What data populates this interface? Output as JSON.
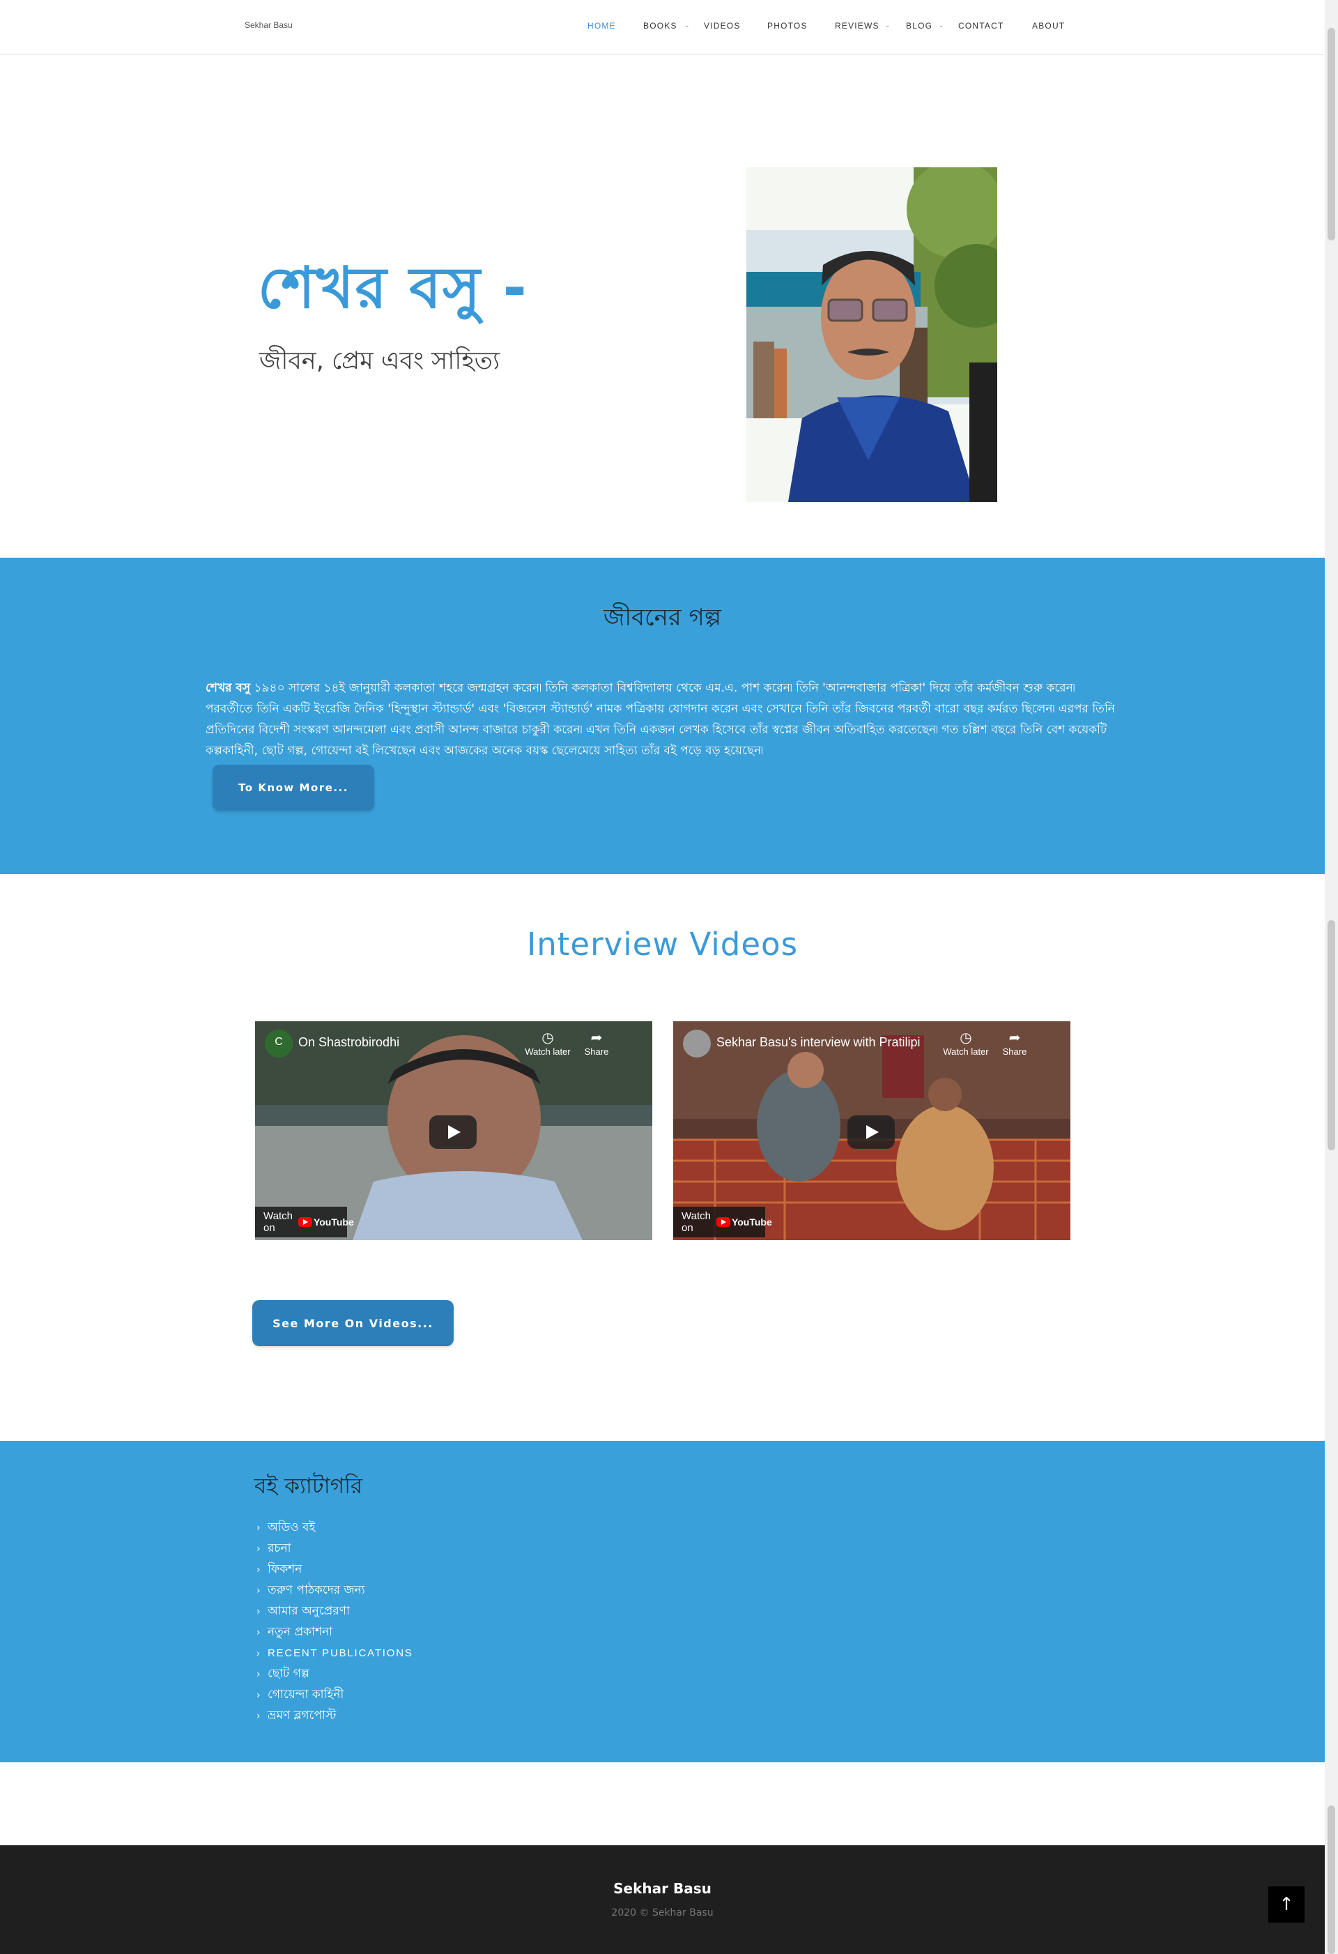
{
  "header": {
    "site_name": "Sekhar Basu",
    "nav": [
      {
        "label": "HOME",
        "active": true
      },
      {
        "label": "BOOKS",
        "has_dropdown": true
      },
      {
        "label": "VIDEOS"
      },
      {
        "label": "PHOTOS"
      },
      {
        "label": "REVIEWS",
        "has_dropdown": true
      },
      {
        "label": "BLOG",
        "has_dropdown": true
      },
      {
        "label": "CONTACT"
      },
      {
        "label": "ABOUT"
      }
    ]
  },
  "hero": {
    "title": "শেখর বসু -",
    "subtitle": "জীবন, প্রেম এবং সাহিত্য",
    "portrait_icon": "portrait-photo"
  },
  "about": {
    "heading": "জীবনের গল্প",
    "name_bold": "শেখর বসু",
    "text": " ১৯৪০ সালের ১৪ই জানুয়ারী কলকাতা শহরে জন্মগ্রহন করেন৷ তিনি কলকাতা বিশ্ববিদ্যালয় থেকে এম.এ. পাশ করেন৷ তিনি 'আনন্দবাজার পত্রিকা' দিয়ে তাঁর কর্মজীবন শুরু করেন৷ পরবর্তীতে তিনি একটি ইংরেজি দৈনিক 'হিন্দুস্থান স্ট্যান্ডার্ড' এবং 'বিজনেস স্ট্যান্ডার্ড' নামক পত্রিকায় যোগদান করেন এবং সেখানে তিনি তাঁর জিবনের পরবর্তী বারো বছর কর্মরত ছিলেন৷ এরপর তিনি প্রতিদিনের বিদেশী সংস্করণ আনন্দমেলা এবং প্রবাসী আনন্দ বাজারে চাকুরী করেন৷ এখন তিনি একজন লেখক হিসেবে তাঁর স্বপ্নের জীবন অতিবাহিত করতেছেন৷ গত চল্লিশ বছরে তিনি বেশ কয়েকটি কল্পকাহিনী, ছোট গল্প, গোয়েন্দা বই লিখেছেন এবং আজকের অনেক বয়স্ক ছেলেমেয়ে সাহিত্য তাঁর বই পড়ে বড় হয়েছেন৷",
    "button": "To Know More..."
  },
  "videos": {
    "heading": "Interview Videos",
    "items": [
      {
        "title": "On Shastrobirodhi",
        "avatar_letter": "C",
        "watch_later": "Watch later",
        "share": "Share",
        "watch_on": "Watch on",
        "yt": "YouTube"
      },
      {
        "title": "Sekhar Basu's interview with Pratilipi",
        "avatar_letter": "",
        "watch_later": "Watch later",
        "share": "Share",
        "watch_on": "Watch on",
        "yt": "YouTube"
      }
    ],
    "button": "See More On Videos..."
  },
  "categories": {
    "heading": "বই ক্যাটাগরি",
    "items": [
      "অডিও বই",
      "রচনা",
      "ফিকশন",
      "তরুণ পাঠকদের জন্য",
      "আমার অনুপ্রেরণা",
      "নতুন প্রকাশনা",
      "RECENT PUBLICATIONS",
      "ছোট গল্প",
      "গোয়েন্দা কাহিনী",
      "ভ্রমণ ব্লগপোস্ট"
    ]
  },
  "footer": {
    "name": "Sekhar Basu",
    "copyright": "2020 © Sekhar Basu",
    "to_top": "↑"
  },
  "colors": {
    "accent": "#3aa0da",
    "button": "#2c7fb8",
    "footer_bg": "#1f1f1f"
  }
}
